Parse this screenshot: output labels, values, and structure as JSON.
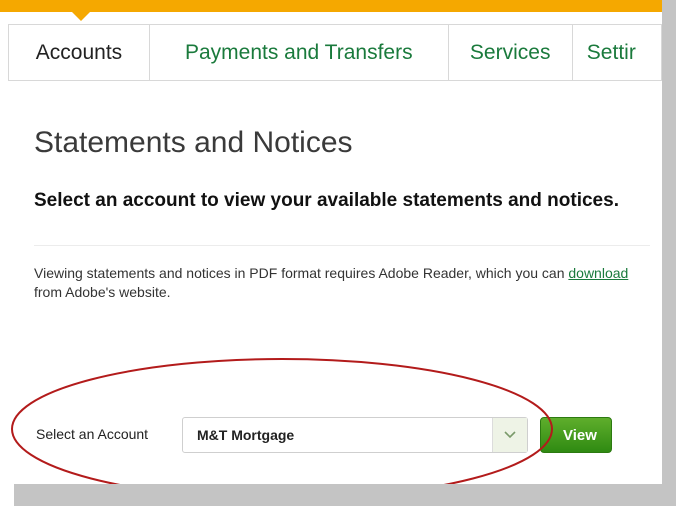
{
  "nav": {
    "tabs": [
      {
        "label": "Accounts",
        "active": true
      },
      {
        "label": "Payments and Transfers",
        "active": false
      },
      {
        "label": "Services",
        "active": false
      },
      {
        "label": "Settir",
        "active": false
      }
    ]
  },
  "page": {
    "title": "Statements and Notices",
    "subtitle": "Select an account to view your available statements and notices.",
    "info_before": "Viewing statements and notices in PDF format requires Adobe Reader, which you can ",
    "info_link": "download",
    "info_after": " from Adobe's website."
  },
  "form": {
    "label": "Select an Account",
    "selected_account": "M&T Mortgage",
    "view_label": "View"
  },
  "icons": {
    "dropdown": "chevron-down-icon"
  },
  "colors": {
    "brand_yellow": "#f5a800",
    "brand_green": "#1a7a3c",
    "button_green": "#3f9a1a",
    "annotation_red": "#b31b1b"
  }
}
